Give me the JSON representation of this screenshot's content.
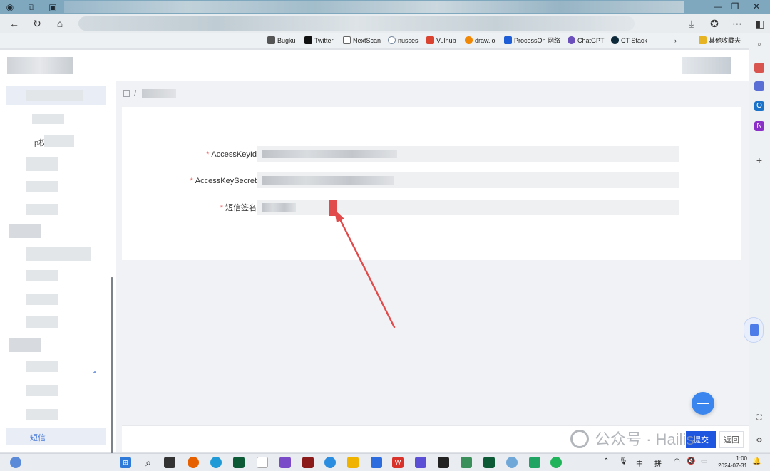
{
  "bookmarks": [
    {
      "label": "Bugku",
      "color": "#555555"
    },
    {
      "label": "Twitter",
      "color": "#111111"
    },
    {
      "label": "NextScan",
      "color": "#666666"
    },
    {
      "label": "nusses",
      "color": "#7a8aa0"
    },
    {
      "label": "Vulhub",
      "color": "#d9432f"
    },
    {
      "label": "draw.io",
      "color": "#f08705"
    },
    {
      "label": "ProcessOn 网络",
      "color": "#1d5dd6"
    },
    {
      "label": "ChatGPT",
      "color": "#6b4fbb"
    },
    {
      "label": "CT Stack",
      "color": "#0e2a3a"
    },
    {
      "label": "其他收藏夹",
      "color": "#e6b422"
    }
  ],
  "sidebar": {
    "partial_label": "p权",
    "footer_label": "短信"
  },
  "form": {
    "fields": [
      {
        "label": "AccessKeyId",
        "required": "*",
        "value": ""
      },
      {
        "label": "AccessKeySecret",
        "required": "*",
        "value": ""
      },
      {
        "label": "短信签名",
        "required": "*",
        "value": ""
      }
    ]
  },
  "actions": {
    "submit": "提交",
    "back": "返回"
  },
  "watermark": {
    "text": "公众号 · Hailis"
  },
  "taskbar": {
    "ime_lang": "中",
    "ime_mode": "拼",
    "time": "1:00",
    "date": "2024-07-31"
  },
  "colors": {
    "primary": "#1e56e0",
    "required": "#f56c6c",
    "annotation": "#e24b4b"
  }
}
